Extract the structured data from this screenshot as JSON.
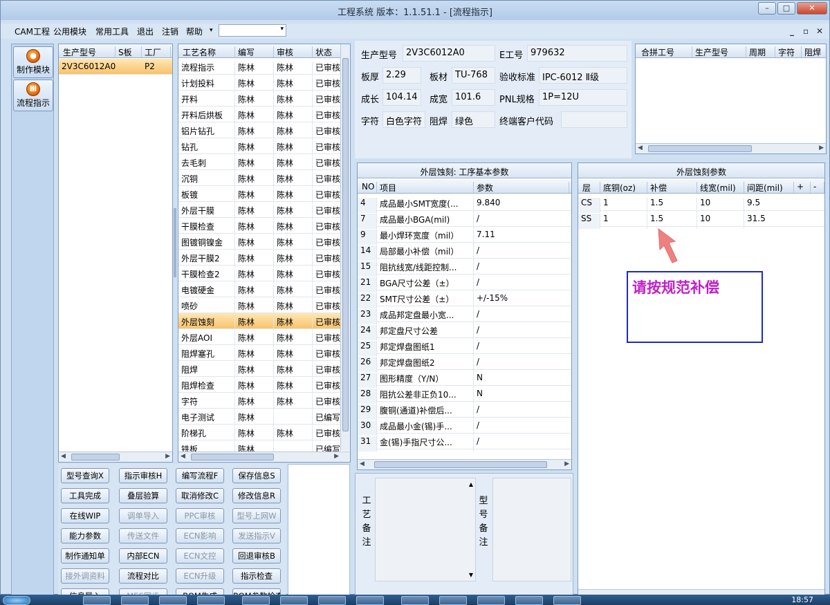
{
  "window": {
    "title": "工程系统   版本：1.1.51.1 - [流程指示]"
  },
  "menu": [
    {
      "label": "CAM工程"
    },
    {
      "label": "公用模块"
    },
    {
      "label": "常用工具"
    },
    {
      "label": "退出"
    },
    {
      "label": "注销"
    },
    {
      "label": "帮助"
    }
  ],
  "menu_combo_value": "",
  "sidebar": {
    "buttons": [
      {
        "label": "制作模块"
      },
      {
        "label": "流程指示"
      }
    ]
  },
  "models_grid": {
    "headers": [
      "生产型号",
      "S板",
      "工厂"
    ],
    "rows": [
      {
        "model": "2V3C6012A0",
        "s": "",
        "factory": "P2"
      }
    ]
  },
  "process_grid": {
    "headers": [
      "工艺名称",
      "编写",
      "审核",
      "状态"
    ],
    "selected": "外层蚀刻",
    "rows": [
      {
        "name": "流程指示",
        "author": "陈林",
        "reviewer": "陈林",
        "status": "已审核"
      },
      {
        "name": "计划投料",
        "author": "陈林",
        "reviewer": "陈林",
        "status": "已审核"
      },
      {
        "name": "开料",
        "author": "陈林",
        "reviewer": "陈林",
        "status": "已审核"
      },
      {
        "name": "开料后烘板",
        "author": "陈林",
        "reviewer": "陈林",
        "status": "已审核"
      },
      {
        "name": "铝片钻孔",
        "author": "陈林",
        "reviewer": "陈林",
        "status": "已审核"
      },
      {
        "name": "钻孔",
        "author": "陈林",
        "reviewer": "陈林",
        "status": "已审核"
      },
      {
        "name": "去毛刺",
        "author": "陈林",
        "reviewer": "陈林",
        "status": "已审核"
      },
      {
        "name": "沉铜",
        "author": "陈林",
        "reviewer": "陈林",
        "status": "已审核"
      },
      {
        "name": "板镀",
        "author": "陈林",
        "reviewer": "陈林",
        "status": "已审核"
      },
      {
        "name": "外层干膜",
        "author": "陈林",
        "reviewer": "陈林",
        "status": "已审核"
      },
      {
        "name": "干膜检查",
        "author": "陈林",
        "reviewer": "陈林",
        "status": "已审核"
      },
      {
        "name": "图镀铜镍金",
        "author": "陈林",
        "reviewer": "陈林",
        "status": "已审核"
      },
      {
        "name": "外层干膜2",
        "author": "陈林",
        "reviewer": "陈林",
        "status": "已审核"
      },
      {
        "name": "干膜检查2",
        "author": "陈林",
        "reviewer": "陈林",
        "status": "已审核"
      },
      {
        "name": "电镀硬金",
        "author": "陈林",
        "reviewer": "陈林",
        "status": "已审核"
      },
      {
        "name": "喷砂",
        "author": "陈林",
        "reviewer": "陈林",
        "status": "已审核"
      },
      {
        "name": "外层蚀刻",
        "author": "陈林",
        "reviewer": "陈林",
        "status": "已审核"
      },
      {
        "name": "外层AOI",
        "author": "陈林",
        "reviewer": "陈林",
        "status": "已审核"
      },
      {
        "name": "阻焊塞孔",
        "author": "陈林",
        "reviewer": "陈林",
        "status": "已审核"
      },
      {
        "name": "阻焊",
        "author": "陈林",
        "reviewer": "陈林",
        "status": "已审核"
      },
      {
        "name": "阻焊检查",
        "author": "陈林",
        "reviewer": "陈林",
        "status": "已审核"
      },
      {
        "name": "字符",
        "author": "陈林",
        "reviewer": "陈林",
        "status": "已审核"
      },
      {
        "name": "电子测试",
        "author": "陈林",
        "reviewer": "",
        "status": "已编写"
      },
      {
        "name": "阶梯孔",
        "author": "陈林",
        "reviewer": "陈林",
        "status": "已审核"
      },
      {
        "name": "铣板",
        "author": "陈林",
        "reviewer": "",
        "status": "已编写"
      }
    ]
  },
  "info": {
    "model_label": "生产型号",
    "model": "2V3C6012A0",
    "e_label": "E工号",
    "e": "979632",
    "thick_label": "板厚",
    "thick": "2.29",
    "material_label": "板材",
    "material": "TU-768",
    "std_label": "验收标准",
    "std": "IPC-6012 Ⅱ级",
    "len_label": "成长",
    "len": "104.14",
    "wid_label": "成宽",
    "wid": "101.6",
    "pnl_label": "PNL规格",
    "pnl": "1P=12U",
    "char_label": "字符",
    "char": "白色字符",
    "mask_label": "阻焊",
    "mask": "绿色",
    "cust_label": "终端客户代码",
    "cust": ""
  },
  "combine_grid": {
    "headers": [
      "合拼工号",
      "生产型号",
      "周期",
      "字符",
      "阻焊"
    ]
  },
  "params_panel": {
    "title": "外层蚀刻: 工序基本参数",
    "headers": [
      "NO",
      "项目",
      "参数"
    ],
    "rows": [
      {
        "no": "4",
        "item": "成品最小SMT宽度(...",
        "value": "9.840"
      },
      {
        "no": "7",
        "item": "成品最小BGA(mil)",
        "value": "/"
      },
      {
        "no": "9",
        "item": "最小焊环宽度（mil）",
        "value": "7.11"
      },
      {
        "no": "14",
        "item": "局部最小补偿（mil）",
        "value": "/"
      },
      {
        "no": "15",
        "item": "阻抗线宽/线距控制...",
        "value": "/"
      },
      {
        "no": "21",
        "item": "BGA尺寸公差（±）",
        "value": "/"
      },
      {
        "no": "22",
        "item": "SMT尺寸公差（±）",
        "value": "+/-15%"
      },
      {
        "no": "23",
        "item": "成品邦定盘最小宽...",
        "value": "/"
      },
      {
        "no": "24",
        "item": "邦定盘尺寸公差",
        "value": "/"
      },
      {
        "no": "25",
        "item": "邦定焊盘图纸1",
        "value": "/"
      },
      {
        "no": "26",
        "item": "邦定焊盘图纸2",
        "value": "/"
      },
      {
        "no": "27",
        "item": "图形精度（Y/N）",
        "value": "N"
      },
      {
        "no": "28",
        "item": "阻抗公差非正负10...",
        "value": "N"
      },
      {
        "no": "29",
        "item": "腹铜(通道)补偿后...",
        "value": "/"
      },
      {
        "no": "30",
        "item": "成品最小金(锡)手...",
        "value": "/"
      },
      {
        "no": "31",
        "item": "金(锡)手指尺寸公...",
        "value": "/"
      }
    ]
  },
  "etch_panel": {
    "title": "外层蚀刻参数",
    "headers": [
      "层",
      "底铜(oz)",
      "补偿",
      "线宽(mil)",
      "间距(mil)",
      "+",
      "-"
    ],
    "rows": [
      {
        "layer": "CS",
        "cu": "1",
        "comp": "1.5",
        "lw": "10",
        "sp": "9.5"
      },
      {
        "layer": "SS",
        "cu": "1",
        "comp": "1.5",
        "lw": "10",
        "sp": "31.5"
      }
    ]
  },
  "annotation": {
    "text": "请按规范补偿",
    "color": "#c020c8"
  },
  "buttons": [
    {
      "label": "型号查询X",
      "disabled": false
    },
    {
      "label": "指示审核H",
      "disabled": false
    },
    {
      "label": "编写流程F",
      "disabled": false
    },
    {
      "label": "保存信息S",
      "disabled": false
    },
    {
      "label": "工具完成",
      "disabled": false
    },
    {
      "label": "叠层验算",
      "disabled": false
    },
    {
      "label": "取消修改C",
      "disabled": false
    },
    {
      "label": "修改信息R",
      "disabled": false
    },
    {
      "label": "在线WIP",
      "disabled": false
    },
    {
      "label": "调单导入",
      "disabled": true
    },
    {
      "label": "PPC审核",
      "disabled": true
    },
    {
      "label": "型号上网W",
      "disabled": true
    },
    {
      "label": "能力参数",
      "disabled": false
    },
    {
      "label": "传送文件",
      "disabled": true
    },
    {
      "label": "ECN影响",
      "disabled": true
    },
    {
      "label": "发送指示V",
      "disabled": true
    },
    {
      "label": "制作通知单",
      "disabled": false
    },
    {
      "label": "内部ECN",
      "disabled": false
    },
    {
      "label": "ECN文控",
      "disabled": true
    },
    {
      "label": "回退审核B",
      "disabled": false
    },
    {
      "label": "接外调资料",
      "disabled": true
    },
    {
      "label": "流程对比",
      "disabled": false
    },
    {
      "label": "ECN升级",
      "disabled": true
    },
    {
      "label": "指示检查",
      "disabled": false
    },
    {
      "label": "信息导入",
      "disabled": false
    },
    {
      "label": "MES同步",
      "disabled": true
    },
    {
      "label": "BOM生成",
      "disabled": false
    },
    {
      "label": "BOM参数检查",
      "disabled": false
    }
  ],
  "remarks": {
    "process_label": "工艺备注",
    "model_label": "型号备注"
  },
  "taskbar": {
    "clock": "18:57"
  },
  "colors": {
    "accent": "#f9c26b",
    "frame": "#cfe0f2"
  }
}
